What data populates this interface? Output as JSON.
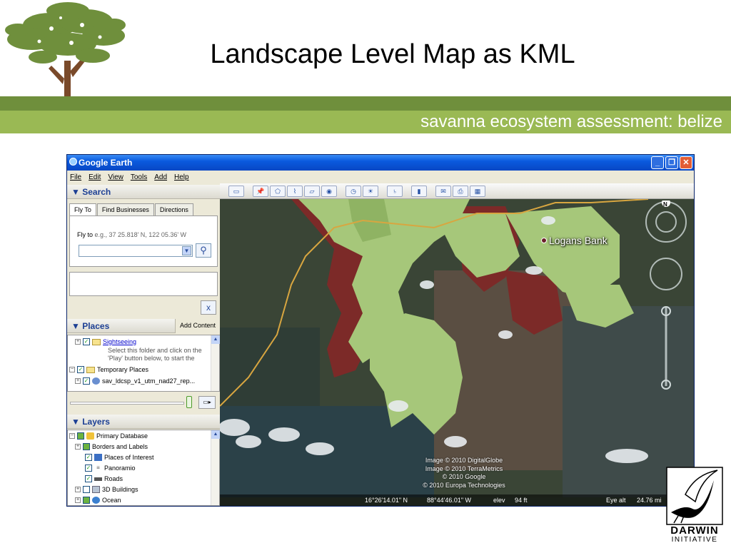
{
  "slide": {
    "title": "Landscape Level Map as KML",
    "subtitle": "savanna ecosystem assessment: belize",
    "logo": {
      "name": "DARWIN",
      "sub": "INITIATIVE"
    },
    "colors": {
      "band_dark": "#6f8f3c",
      "band_light": "#9ab954"
    }
  },
  "window": {
    "title": "Google Earth",
    "controls": [
      "minimize-icon",
      "restore-icon",
      "close-icon"
    ]
  },
  "menu": [
    "File",
    "Edit",
    "View",
    "Tools",
    "Add",
    "Help"
  ],
  "search": {
    "header": "Search",
    "tabs": [
      "Fly To",
      "Find Businesses",
      "Directions"
    ],
    "active_tab": "Fly To",
    "flyto_label": "Fly to",
    "flyto_hint": "e.g., 37 25.818' N, 122 05.36' W",
    "input_value": "",
    "clear_label": "x"
  },
  "places": {
    "header": "Places",
    "add_content": "Add Content",
    "items": [
      {
        "label": "Sightseeing",
        "note1": "Select this folder and click on the",
        "note2": "'Play' button below, to start the"
      },
      {
        "label": "Temporary Places"
      },
      {
        "label": "sav_ldcsp_v1_utm_nad27_rep..."
      }
    ]
  },
  "layers": {
    "header": "Layers",
    "items": [
      "Primary Database",
      "Borders and Labels",
      "Places of Interest",
      "Panoramio",
      "Roads",
      "3D Buildings",
      "Ocean"
    ]
  },
  "map": {
    "placemark": "Logans Bank",
    "credits": [
      "Image © 2010 DigitalGlobe",
      "Image © 2010 TerraMetrics",
      "© 2010 Google",
      "© 2010 Europa Technologies"
    ],
    "status": {
      "lat": "16°26'14.01\" N",
      "lon": "88°44'46.01\" W",
      "elev_label": "elev",
      "elev_value": "94 ft",
      "eye_label": "Eye alt",
      "eye_value": "24.76 mi"
    },
    "compass_north": "N",
    "colors": {
      "savanna_light": "#a6c77a",
      "savanna_dark": "#7c2a28",
      "forest": "#3f4d35",
      "road": "#d8a640"
    }
  },
  "toolbar_icons": [
    "sidebar-icon",
    "placemark-icon",
    "polygon-icon",
    "path-icon",
    "overlay-icon",
    "tour-icon",
    "historical-imagery-icon",
    "sunlight-icon",
    "planets-icon",
    "ruler-icon",
    "email-icon",
    "print-icon",
    "maps-icon"
  ]
}
